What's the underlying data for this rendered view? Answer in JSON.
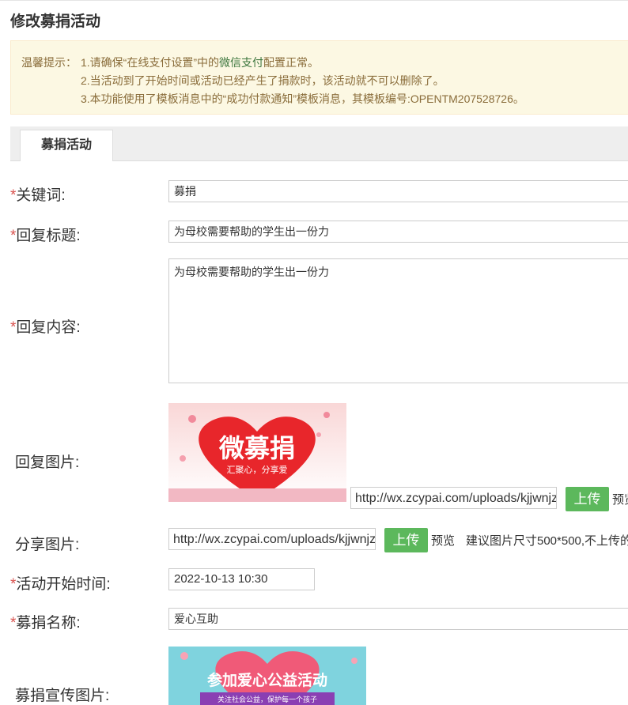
{
  "page_title": "修改募捐活动",
  "notice": {
    "label": "温馨提示：",
    "line1_prefix": "1.请确保“在线支付设置”中的",
    "line1_link": "微信支付",
    "line1_suffix": "配置正常。",
    "line2": "2.当活动到了开始时间或活动已经产生了捐款时，该活动就不可以删除了。",
    "line3": "3.本功能使用了模板消息中的“成功付款通知”模板消息，其模板编号:OPENTM207528726。"
  },
  "tab": {
    "label": "募捐活动"
  },
  "form": {
    "keyword": {
      "required": "*",
      "label": "关键词:",
      "value": "募捐"
    },
    "reply_title": {
      "required": "*",
      "label": "回复标题:",
      "value": "为母校需要帮助的学生出一份力"
    },
    "reply_content": {
      "required": "*",
      "label": "回复内容:",
      "value": "为母校需要帮助的学生出一份力"
    },
    "reply_image": {
      "label": "回复图片:",
      "image_text": "微募捐",
      "image_subtext": "汇聚心，分享爱",
      "url": "http://wx.zcypai.com/uploads/kjjwnjzx/image",
      "upload_label": "上传",
      "preview_label": "预览"
    },
    "share_image": {
      "label": "分享图片:",
      "url": "http://wx.zcypai.com/uploads/kjjwnjzx/image",
      "upload_label": "上传",
      "preview_label": "预览",
      "hint": "建议图片尺寸500*500,不上传的"
    },
    "start_time": {
      "required": "*",
      "label": "活动开始时间:",
      "value": "2022-10-13 10:30"
    },
    "donation_name": {
      "required": "*",
      "label": "募捐名称:",
      "value": "爱心互助"
    },
    "promo_image": {
      "label": "募捐宣传图片:",
      "image_text": "参加爱心公益活动",
      "image_subtext": "关注社会公益，保护每一个孩子"
    }
  },
  "colors": {
    "required": "#d9534f",
    "notice_bg": "#fcf8e3",
    "notice_text": "#8a6d3b",
    "link_green": "#3c763d",
    "upload_button": "#5cb85c"
  }
}
